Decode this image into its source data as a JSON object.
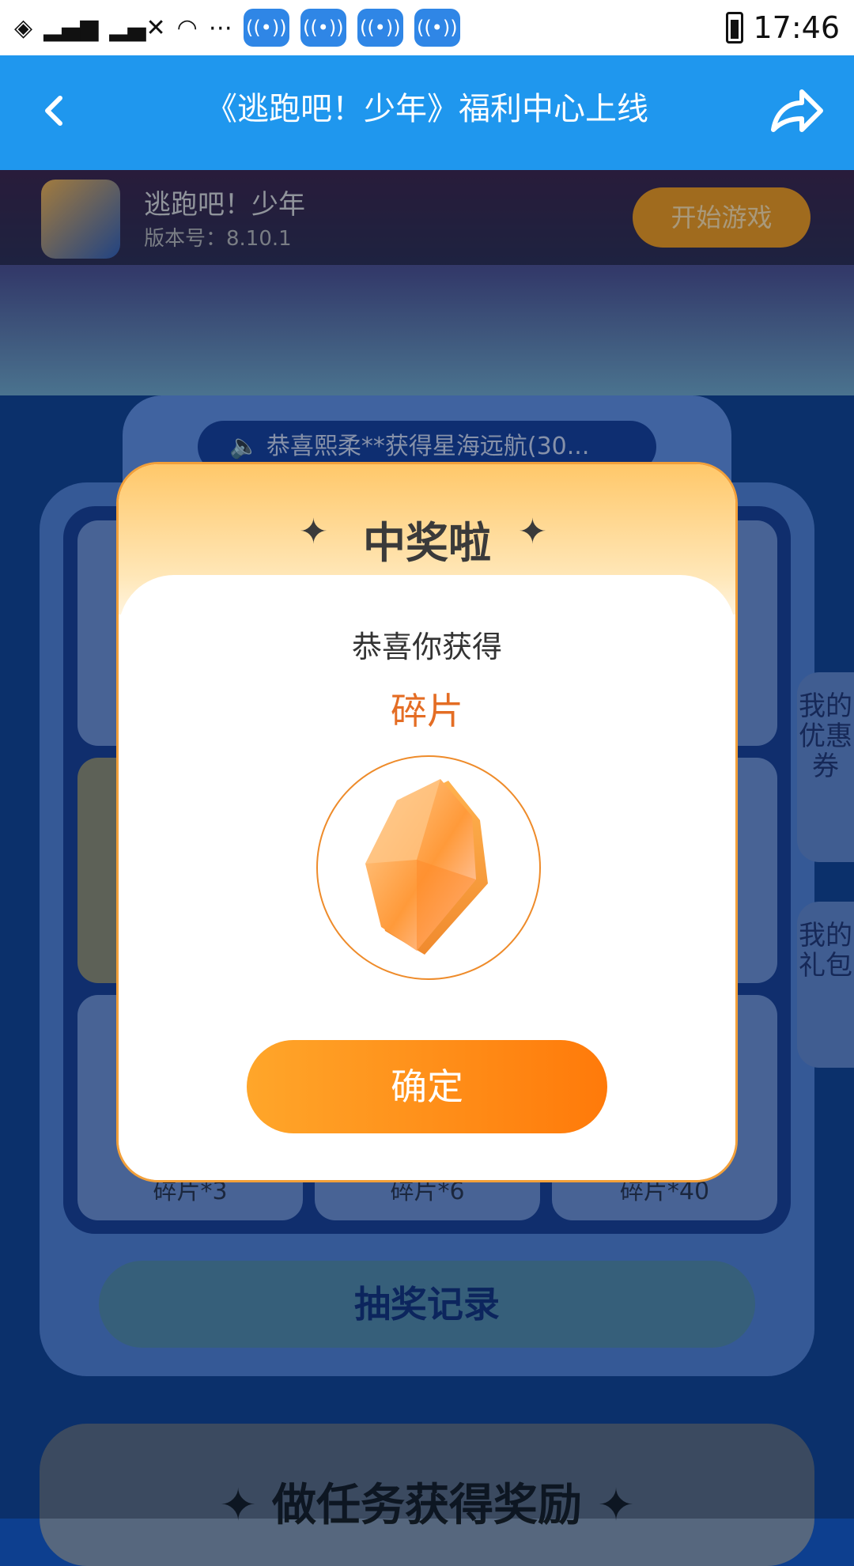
{
  "status_bar": {
    "more": "⋯",
    "hotspots": [
      "((•))",
      "((•))",
      "((•))",
      "((•))"
    ],
    "time": "17:46"
  },
  "app_bar": {
    "back_icon": "chevron-left-icon",
    "title": "《逃跑吧！少年》福利中心上线",
    "share_icon": "share-icon"
  },
  "banner": {
    "app_name": "逃跑吧！少年",
    "version": "版本号：8.10.1",
    "start_button": "开始游戏"
  },
  "marquee": {
    "text": "恭喜熙柔**获得星海远航(30..."
  },
  "grid_labels": {
    "left": "碎片*3",
    "middle": "碎片*6",
    "right": "碎片*40"
  },
  "record_button": "抽奖记录",
  "side_tabs": {
    "coupons": "我的优惠券",
    "gifts": "我的礼包"
  },
  "bottom_card_title": "✦ 做任务获得奖励 ✦",
  "modal": {
    "title": "中奖啦",
    "congrats": "恭喜你获得",
    "prize_name": "碎片",
    "confirm": "确定"
  },
  "colors": {
    "appbar": "#1f97ee",
    "confirm_start": "#ffa62a",
    "confirm_end": "#ff7a0a",
    "prize_text": "#e46d24"
  }
}
